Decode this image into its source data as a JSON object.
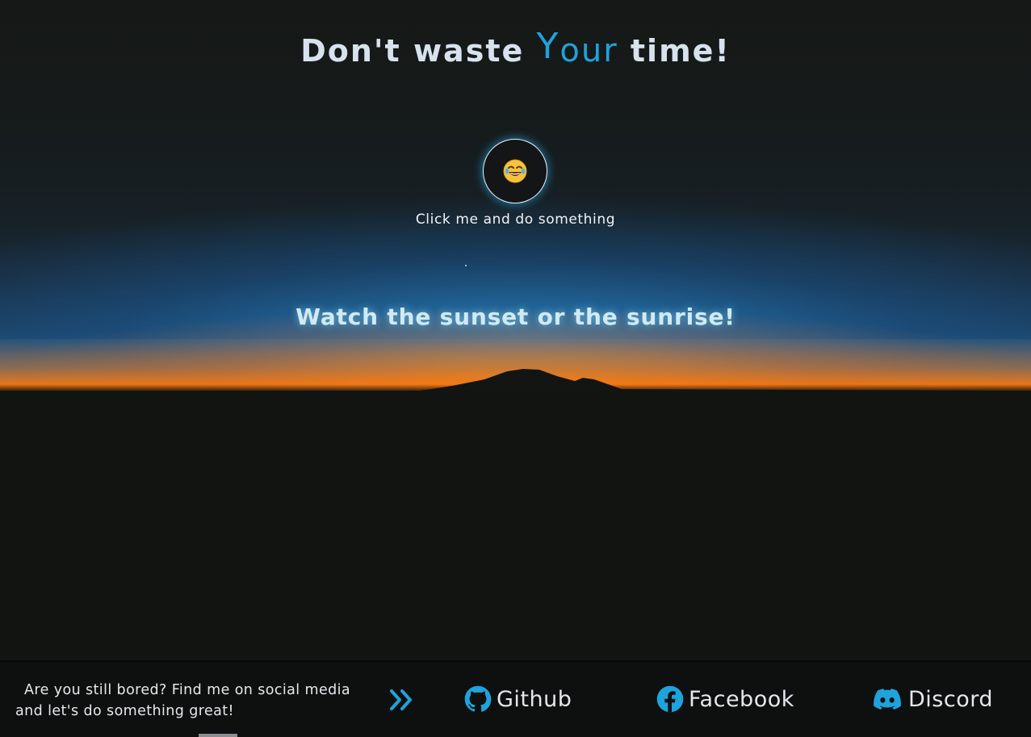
{
  "header": {
    "title_before": "Don't waste ",
    "title_accent": "Your",
    "title_after": " time!"
  },
  "hero": {
    "emoji_icon": "face-with-tears-of-joy-icon",
    "button_label": "Click me and do something",
    "subtitle": "Watch the sunset or the sunrise!"
  },
  "footer": {
    "tagline_line1": "Are you still bored? Find me on social media",
    "tagline_line2": "and let's do something great!",
    "arrows_icon": "double-chevron-right-icon",
    "links": [
      {
        "label": "Github",
        "icon": "github-icon"
      },
      {
        "label": "Facebook",
        "icon": "facebook-icon"
      },
      {
        "label": "Discord",
        "icon": "discord-icon"
      }
    ]
  },
  "colors": {
    "accent": "#1ea3dc",
    "heading": "#d8e2ee",
    "background": "#121411",
    "footer_background": "#0e100f"
  }
}
